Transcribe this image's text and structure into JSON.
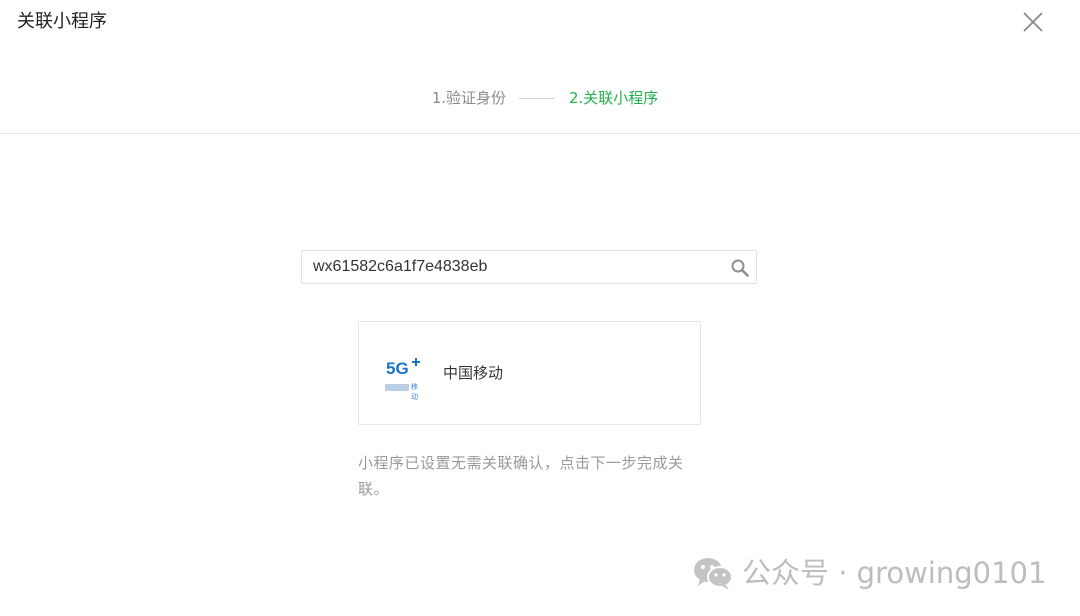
{
  "dialog": {
    "title": "关联小程序"
  },
  "steps": [
    {
      "label": "1.验证身份",
      "state": "completed"
    },
    {
      "label": "2.关联小程序",
      "state": "active"
    }
  ],
  "search": {
    "value": "wx61582c6a1f7e4838eb",
    "placeholder": ""
  },
  "result_card": {
    "logo_text": "5G",
    "logo_sub": "移动",
    "name": "中国移动"
  },
  "hint": "小程序已设置无需关联确认，点击下一步完成关联。",
  "watermark": "公众号 · growing0101",
  "colors": {
    "accent": "#23b14d",
    "text_primary": "#353535",
    "text_secondary": "#9a9a9a",
    "border": "#e5e5e5",
    "logo_blue": "#1a76c9"
  }
}
